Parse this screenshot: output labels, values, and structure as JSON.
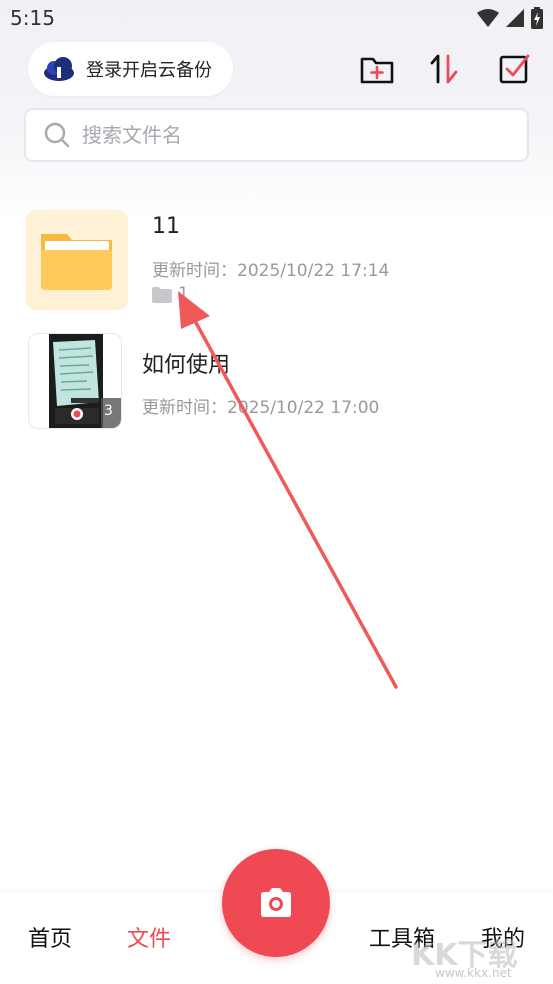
{
  "status_bar": {
    "time": "5:15"
  },
  "header": {
    "cloud_backup_label": "登录开启云备份"
  },
  "search": {
    "placeholder": "搜索文件名"
  },
  "files": [
    {
      "title": "11",
      "meta": "更新时间：2025/10/22 17:14",
      "count": "1"
    },
    {
      "title": "如何使用",
      "meta": "更新时间：2025/10/22 17:00",
      "page_count": "3"
    }
  ],
  "tab_bar": {
    "home": "首页",
    "files": "文件",
    "tools": "工具箱",
    "mine": "我的"
  },
  "watermark": {
    "brand": "KK下载",
    "url": "www.kkx.net"
  },
  "colors": {
    "accent": "#ef4953",
    "folder_bg": "#fff1d6",
    "folder": "#ffc24a"
  }
}
